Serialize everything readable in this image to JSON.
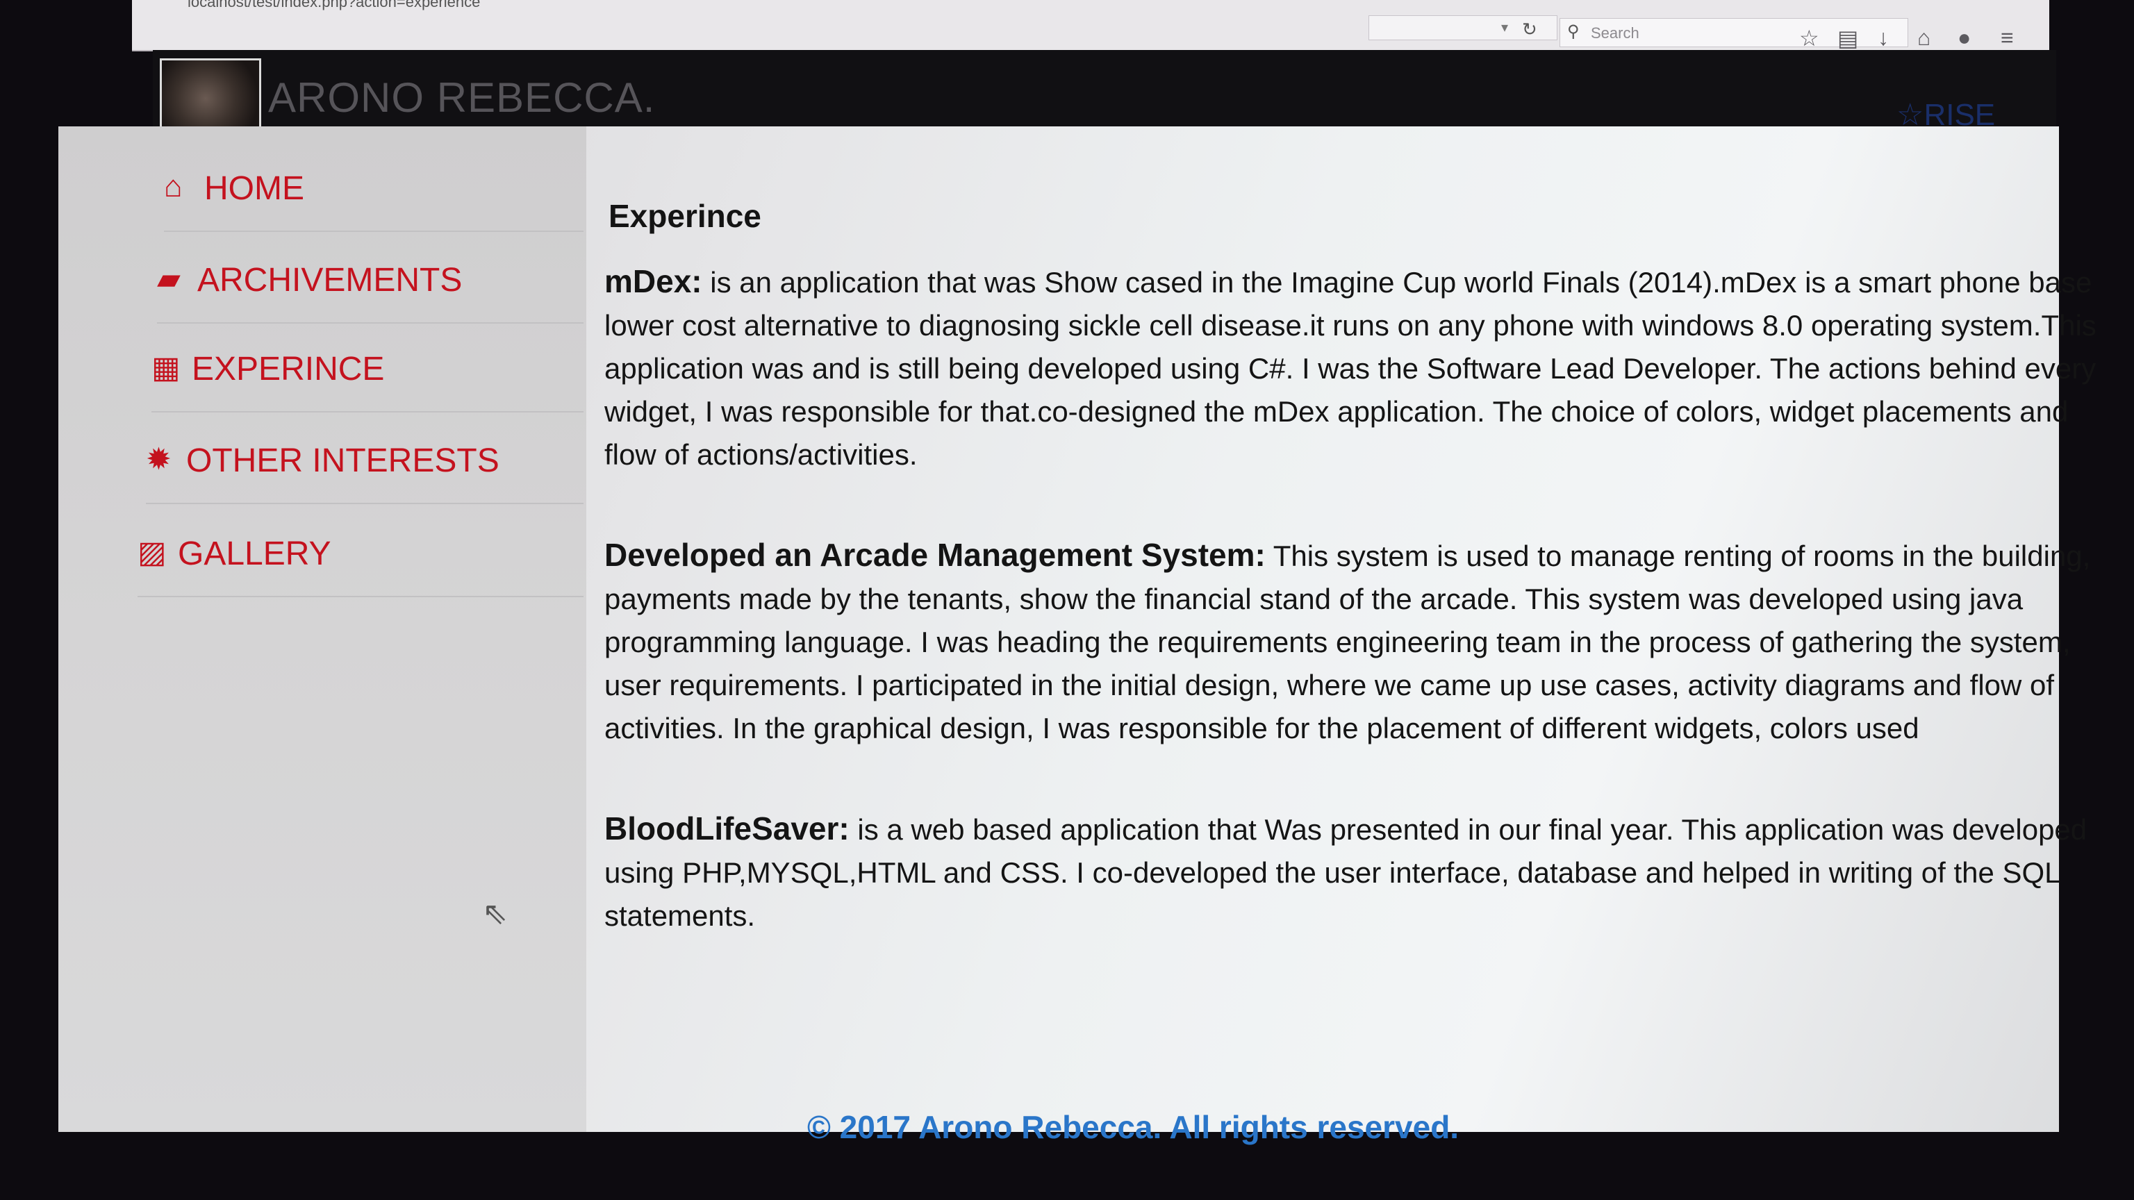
{
  "browser": {
    "url": "localhost/test/index.php?action=experience",
    "search_placeholder": "Search"
  },
  "header": {
    "title": "ARONO REBECCA.",
    "rise_label": "RISE"
  },
  "nav": {
    "items": [
      {
        "label": "HOME",
        "icon": "home-icon"
      },
      {
        "label": "ARCHIVEMENTS",
        "icon": "trophy-icon"
      },
      {
        "label": "EXPERINCE",
        "icon": "briefcase-icon"
      },
      {
        "label": "OTHER INTERESTS",
        "icon": "cog-icon"
      },
      {
        "label": "GALLERY",
        "icon": "picture-icon"
      }
    ]
  },
  "content": {
    "heading": "Experince",
    "entries": [
      {
        "title": "mDex:",
        "text": " is an application that was Show cased in the Imagine Cup world Finals (2014).mDex is a smart phone base lower cost alternative to diagnosing sickle cell disease.it runs on any phone with windows 8.0 operating system.This application was and is still being developed using C#. I was the Software Lead Developer. The actions behind every widget, I was responsible for that.co-designed the mDex application. The choice of colors, widget placements and flow of actions/activities."
      },
      {
        "title": "Developed an Arcade Management System:",
        "text": " This system is used to manage renting of rooms in the building, payments made by the tenants, show the financial stand of the arcade. This system was developed using java programming language. I was heading the requirements engineering team in the process of gathering the system, user requirements. I participated in the initial design, where we came up use cases, activity diagrams and flow of activities. In the graphical design, I was responsible for the placement of different widgets, colors used"
      },
      {
        "title": "BloodLifeSaver:",
        "text": " is a web based application that Was presented in our final year. This application was developed using PHP,MYSQL,HTML and CSS. I co-developed the user interface, database and helped in writing of the SQL statements."
      }
    ]
  },
  "footer": {
    "text": "© 2017 Arono Rebecca. All rights reserved."
  },
  "colors": {
    "nav_red": "#c4121e",
    "footer_blue": "#2a76c9"
  }
}
